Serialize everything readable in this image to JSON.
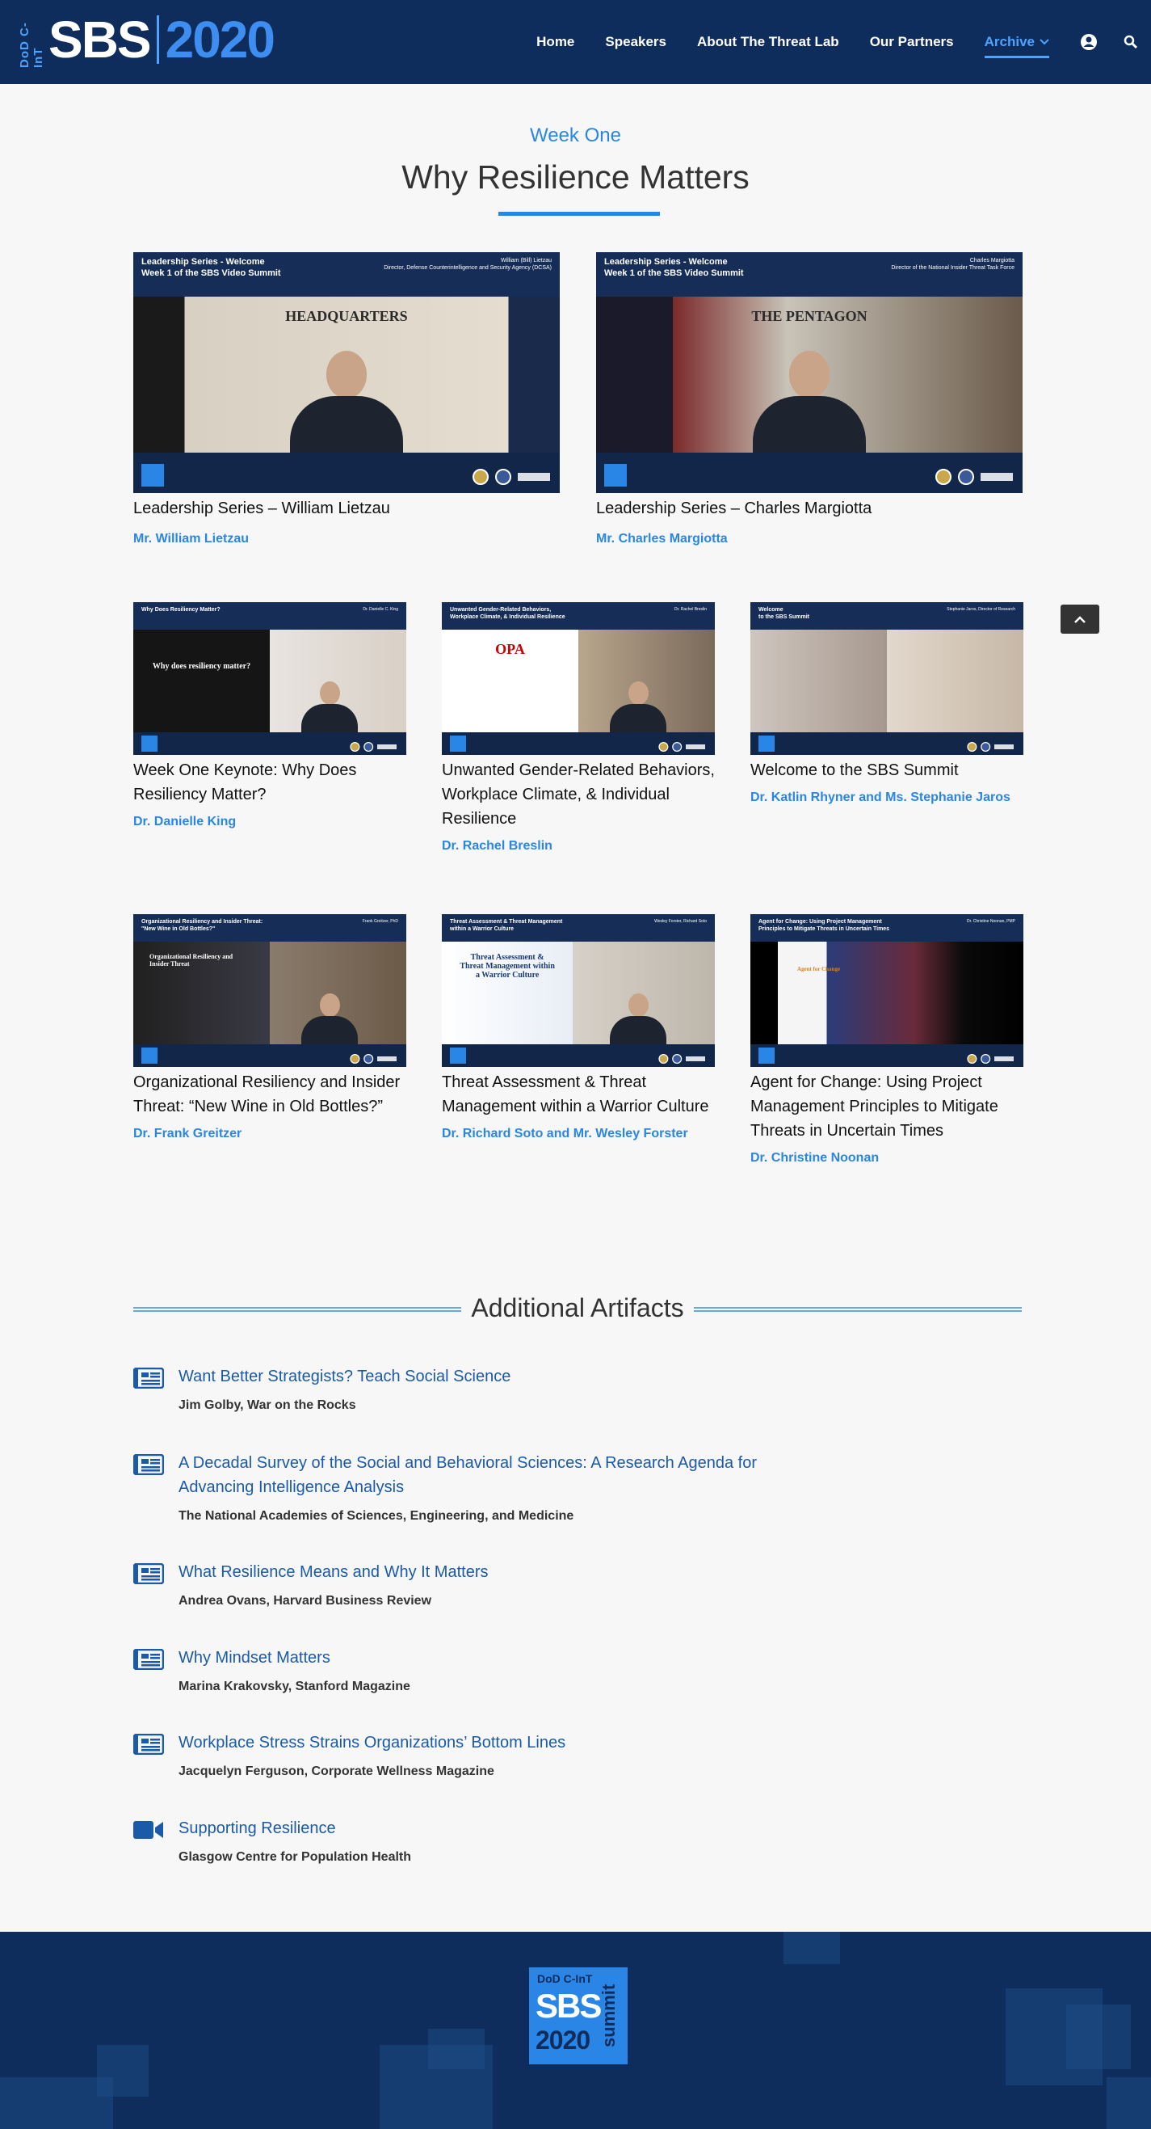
{
  "header": {
    "logo": {
      "dod": "DoD C-InT",
      "sbs": "SBS",
      "year": "2020"
    },
    "nav": [
      "Home",
      "Speakers",
      "About The Threat Lab",
      "Our Partners",
      "Archive"
    ],
    "active_nav": "Archive",
    "icons": [
      "user-circle-icon",
      "search-icon"
    ]
  },
  "section": {
    "kicker": "Week One",
    "title": "Why Resilience Matters"
  },
  "videos": [
    {
      "title": "Leadership Series – William Lietzau",
      "author": "Mr. William Lietzau",
      "thumb_title": "Leadership Series - Welcome\nWeek 1 of the SBS Video Summit",
      "thumb_speaker": "William (Bill) Lietzau\nDirector, Defense Counterintelligence and Security Agency (DCSA)",
      "thumb_bg": "HEADQUARTERS"
    },
    {
      "title": "Leadership Series – Charles Margiotta",
      "author": "Mr. Charles Margiotta",
      "thumb_title": "Leadership Series - Welcome\nWeek 1 of the SBS Video Summit",
      "thumb_speaker": "Charles Margiotta\nDirector of the National Insider Threat Task Force",
      "thumb_bg": "THE PENTAGON"
    },
    {
      "title": "Week One Keynote: Why Does Resiliency Matter?",
      "author": "Dr. Danielle King",
      "thumb_title": "Why Does Resiliency Matter?",
      "thumb_speaker": "Dr. Danielle C. King",
      "thumb_bg": "Why does resiliency matter?"
    },
    {
      "title": "Unwanted Gender-Related Behaviors, Workplace Climate, & Individual Resilience",
      "author": "Dr. Rachel Breslin",
      "thumb_title": "Unwanted Gender-Related Behaviors,\nWorkplace Climate, & Individual Resilience",
      "thumb_speaker": "Dr. Rachel Breslin",
      "thumb_bg": "OPA"
    },
    {
      "title": "Welcome to the SBS Summit",
      "author": "Dr. Katlin Rhyner and Ms. Stephanie Jaros",
      "thumb_title": "Welcome\nto the SBS Summit",
      "thumb_speaker": "Stephanie Jaros, Director of Research",
      "thumb_bg": ""
    },
    {
      "title": "Organizational Resiliency and Insider Threat: “New Wine in Old Bottles?”",
      "author": "Dr. Frank Greitzer",
      "thumb_title": "Organizational Resiliency and Insider Threat:\n\"New Wine in Old Bottles?\"",
      "thumb_speaker": "Frank Greitzer, PhD",
      "thumb_bg": "Organizational Resiliency and Insider Threat"
    },
    {
      "title": "Threat Assessment & Threat Management within a Warrior Culture",
      "author": "Dr. Richard Soto and Mr. Wesley Forster",
      "thumb_title": "Threat Assessment & Threat Management\nwithin a Warrior Culture",
      "thumb_speaker": "Wesley Forster, Richard Soto",
      "thumb_bg": "Threat Assessment & Threat Management within a Warrior Culture"
    },
    {
      "title": "Agent for Change: Using Project Management Principles to Mitigate Threats in Uncertain Times",
      "author": "Dr. Christine Noonan",
      "thumb_title": "Agent for Change: Using Project Management\nPrinciples to Mitigate Threats in Uncertain Times",
      "thumb_speaker": "Dr. Christine Noonan, PMP",
      "thumb_bg": "Agent for Change"
    }
  ],
  "artifacts": {
    "title": "Additional Artifacts",
    "items": [
      {
        "title": "Want Better Strategists? Teach Social Science",
        "source": "Jim Golby, War on the Rocks",
        "icon": "article-icon"
      },
      {
        "title": "A Decadal Survey of the Social and Behavioral Sciences: A Research Agenda for Advancing Intelligence Analysis",
        "source": "The National Academies of Sciences, Engineering, and Medicine",
        "icon": "article-icon"
      },
      {
        "title": "What Resilience Means and Why It Matters",
        "source": "Andrea Ovans, Harvard Business Review",
        "icon": "article-icon"
      },
      {
        "title": "Why Mindset Matters",
        "source": "Marina Krakovsky, Stanford Magazine",
        "icon": "article-icon"
      },
      {
        "title": "Workplace Stress Strains Organizations’ Bottom Lines",
        "source": "Jacquelyn Ferguson, Corporate Wellness Magazine",
        "icon": "article-icon"
      },
      {
        "title": "Supporting Resilience",
        "source": "Glasgow Centre for Population Health",
        "icon": "video-camera-icon"
      }
    ]
  },
  "footer": {
    "logo": {
      "dod": "DoD C-InT",
      "sbs": "SBS",
      "year": "2020",
      "summit": "summit"
    }
  },
  "colors": {
    "navy": "#0f2d5c",
    "accent": "#2a86e6",
    "link": "#1a5aa8"
  }
}
